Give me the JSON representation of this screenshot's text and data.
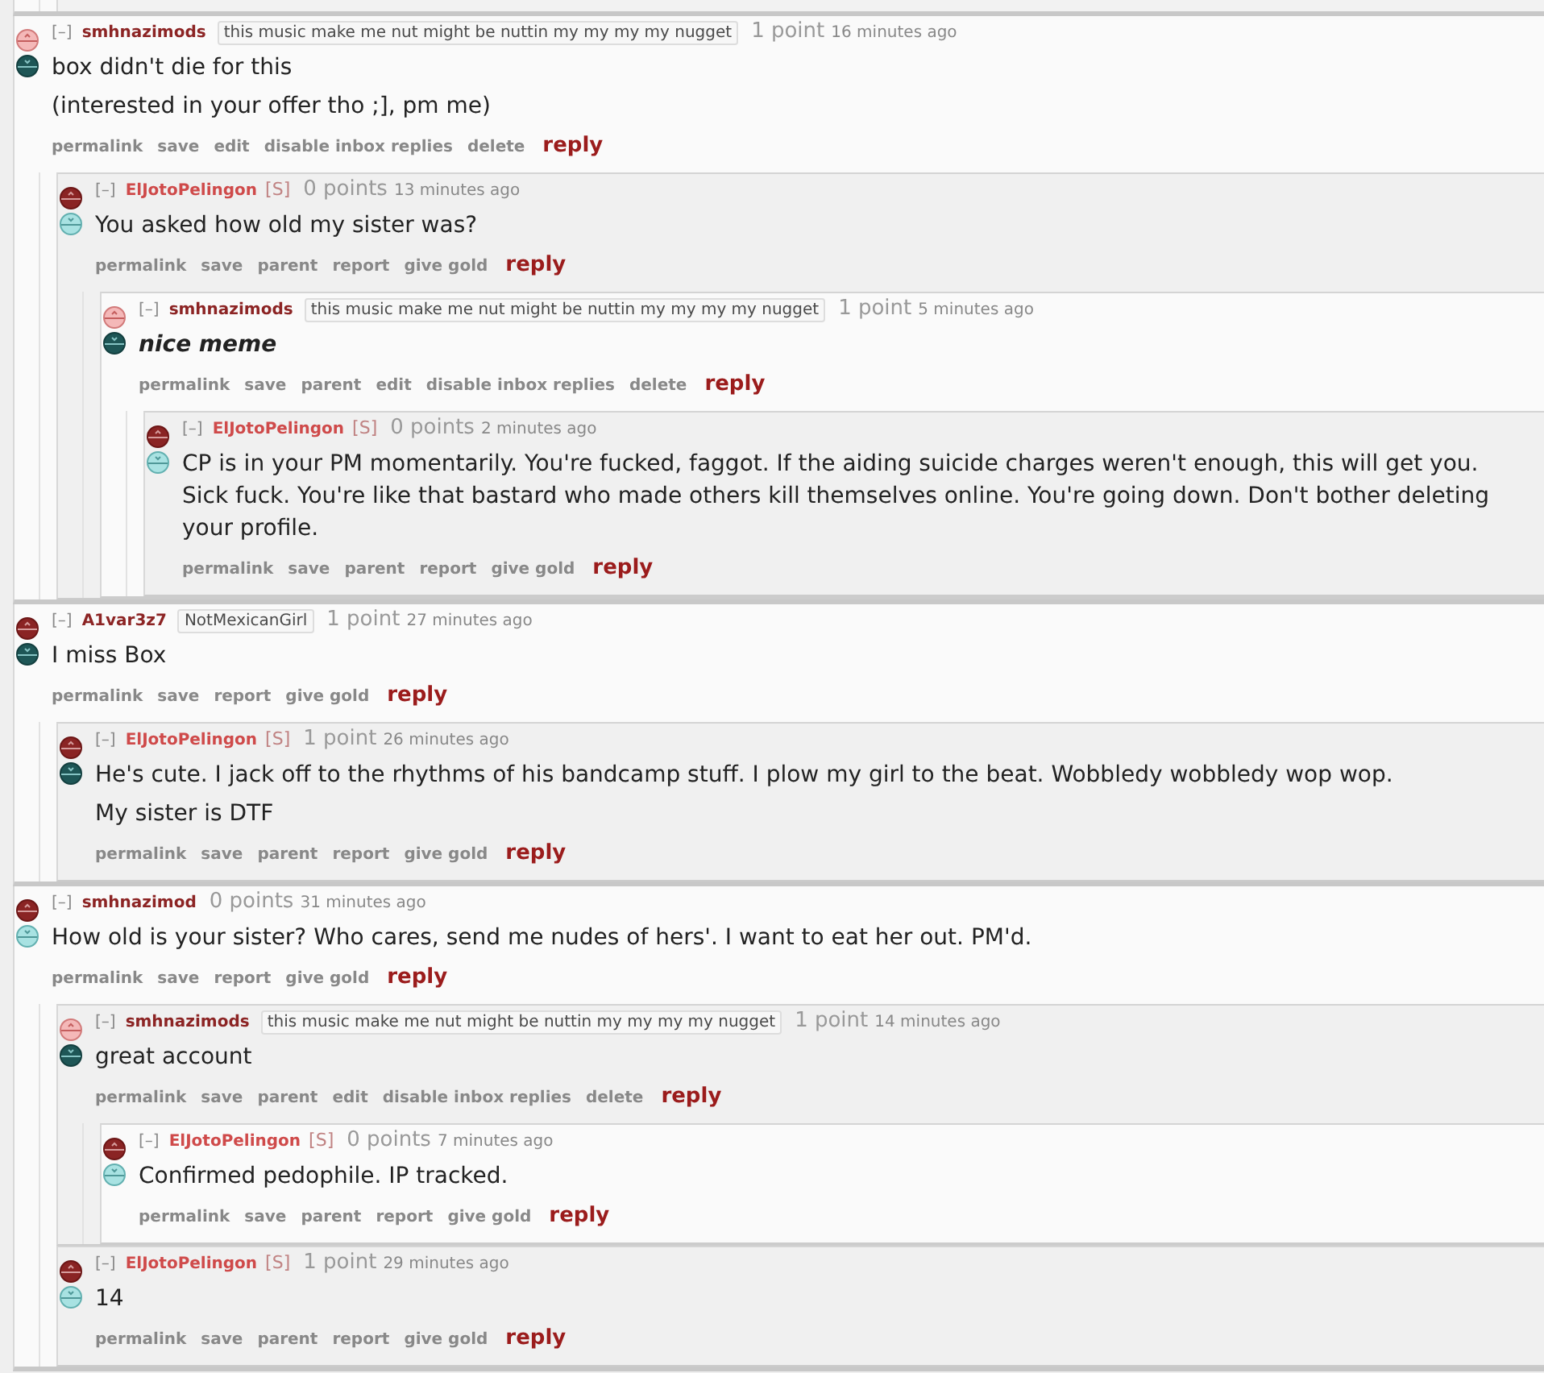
{
  "comments": [
    {
      "toggle": "[–]",
      "author": "smhnazimods",
      "submitter": false,
      "flair": "this music make me nut might be nuttin my my my my nugget",
      "score": "1 point",
      "time": "16 minutes ago",
      "upvoted": true,
      "downvoted": false,
      "emphasized": false,
      "body": [
        "box didn't die for this",
        "(interested in your offer tho ;], pm me)"
      ],
      "actions": [
        "permalink",
        "save",
        "edit",
        "disable inbox replies",
        "delete"
      ],
      "reply": "reply",
      "children": [
        {
          "toggle": "[–]",
          "author": "ElJotoPelingon",
          "submitter": true,
          "tag": "[S]",
          "score": "0 points",
          "time": "13 minutes ago",
          "upvoted": false,
          "downvoted": true,
          "emphasized": false,
          "body": [
            "You asked how old my sister was?"
          ],
          "actions": [
            "permalink",
            "save",
            "parent",
            "report",
            "give gold"
          ],
          "reply": "reply",
          "children": [
            {
              "toggle": "[–]",
              "author": "smhnazimods",
              "submitter": false,
              "flair": "this music make me nut might be nuttin my my my my nugget",
              "score": "1 point",
              "time": "5 minutes ago",
              "upvoted": true,
              "downvoted": false,
              "emphasized": true,
              "body": [
                "nice meme"
              ],
              "actions": [
                "permalink",
                "save",
                "parent",
                "edit",
                "disable inbox replies",
                "delete"
              ],
              "reply": "reply",
              "children": [
                {
                  "toggle": "[–]",
                  "author": "ElJotoPelingon",
                  "submitter": true,
                  "tag": "[S]",
                  "score": "0 points",
                  "time": "2 minutes ago",
                  "upvoted": false,
                  "downvoted": true,
                  "emphasized": false,
                  "body": [
                    "CP is in your PM momentarily. You're fucked, faggot. If the aiding suicide charges weren't enough, this will get you. Sick fuck. You're like that bastard who made others kill themselves online. You're going down. Don't bother deleting your profile."
                  ],
                  "actions": [
                    "permalink",
                    "save",
                    "parent",
                    "report",
                    "give gold"
                  ],
                  "reply": "reply"
                }
              ]
            }
          ]
        }
      ]
    },
    {
      "toggle": "[–]",
      "author": "A1var3z7",
      "submitter": false,
      "flair": "NotMexicanGirl",
      "score": "1 point",
      "time": "27 minutes ago",
      "upvoted": false,
      "downvoted": false,
      "emphasized": false,
      "body": [
        "I miss Box"
      ],
      "actions": [
        "permalink",
        "save",
        "report",
        "give gold"
      ],
      "reply": "reply",
      "children": [
        {
          "toggle": "[–]",
          "author": "ElJotoPelingon",
          "submitter": true,
          "tag": "[S]",
          "score": "1 point",
          "time": "26 minutes ago",
          "upvoted": false,
          "downvoted": false,
          "emphasized": false,
          "body": [
            "He's cute. I jack off to the rhythms of his bandcamp stuff. I plow my girl to the beat. Wobbledy wobbledy wop wop.",
            "My sister is DTF"
          ],
          "actions": [
            "permalink",
            "save",
            "parent",
            "report",
            "give gold"
          ],
          "reply": "reply"
        }
      ]
    },
    {
      "toggle": "[–]",
      "author": "smhnazimod",
      "submitter": false,
      "score": "0 points",
      "time": "31 minutes ago",
      "upvoted": false,
      "downvoted": true,
      "emphasized": false,
      "body": [
        "How old is your sister? Who cares, send me nudes of hers'. I want to eat her out. PM'd."
      ],
      "actions": [
        "permalink",
        "save",
        "report",
        "give gold"
      ],
      "reply": "reply",
      "children": [
        {
          "toggle": "[–]",
          "author": "smhnazimods",
          "submitter": false,
          "flair": "this music make me nut might be nuttin my my my my nugget",
          "score": "1 point",
          "time": "14 minutes ago",
          "upvoted": true,
          "downvoted": false,
          "emphasized": false,
          "body": [
            "great account"
          ],
          "actions": [
            "permalink",
            "save",
            "parent",
            "edit",
            "disable inbox replies",
            "delete"
          ],
          "reply": "reply",
          "children": [
            {
              "toggle": "[–]",
              "author": "ElJotoPelingon",
              "submitter": true,
              "tag": "[S]",
              "score": "0 points",
              "time": "7 minutes ago",
              "upvoted": false,
              "downvoted": true,
              "emphasized": false,
              "body": [
                "Confirmed pedophile. IP tracked."
              ],
              "actions": [
                "permalink",
                "save",
                "parent",
                "report",
                "give gold"
              ],
              "reply": "reply"
            }
          ]
        },
        {
          "toggle": "[–]",
          "author": "ElJotoPelingon",
          "submitter": true,
          "tag": "[S]",
          "score": "1 point",
          "time": "29 minutes ago",
          "upvoted": false,
          "downvoted": true,
          "emphasized": false,
          "body": [
            "14"
          ],
          "actions": [
            "permalink",
            "save",
            "parent",
            "report",
            "give gold"
          ],
          "reply": "reply"
        }
      ]
    }
  ]
}
